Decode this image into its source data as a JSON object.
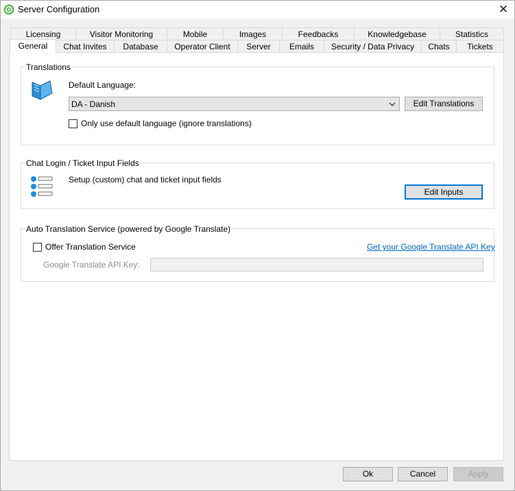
{
  "window": {
    "title": "Server Configuration",
    "close_glyph": "✕"
  },
  "tabs_row_top": [
    "Licensing",
    "Visitor Monitoring",
    "Mobile",
    "Images",
    "Feedbacks",
    "Knowledgebase",
    "Statistics"
  ],
  "tabs_row_bottom": [
    "General",
    "Chat Invites",
    "Database",
    "Operator Client",
    "Server",
    "Emails",
    "Security / Data Privacy",
    "Chats",
    "Tickets"
  ],
  "selected_tab": "General",
  "translations": {
    "legend": "Translations",
    "default_language_label": "Default Language:",
    "default_language_value": "DA - Danish",
    "edit_translations_button": "Edit Translations",
    "only_default_checkbox_label": "Only use default language (ignore translations)",
    "only_default_checked": false
  },
  "input_fields": {
    "legend": "Chat Login / Ticket Input Fields",
    "description": "Setup (custom) chat and ticket input fields",
    "edit_inputs_button": "Edit Inputs"
  },
  "auto_translation": {
    "legend": "Auto Translation Service (powered by Google Translate)",
    "offer_checkbox_label": "Offer Translation Service",
    "offer_checked": false,
    "api_key_link": "Get your Google Translate API Key",
    "api_key_label": "Google Translate API Key:",
    "api_key_value": ""
  },
  "footer": {
    "ok": "Ok",
    "cancel": "Cancel",
    "apply": "Apply"
  },
  "colors": {
    "accent": "#0078d7",
    "link": "#0066cc",
    "book_icon": "#2a8fd6",
    "list_icon": "#1f8ce0",
    "app_icon": "#5cb85c"
  },
  "icons": [
    "app-gear-icon",
    "book-icon",
    "list-icon",
    "chevron-down-icon",
    "close-icon"
  ]
}
